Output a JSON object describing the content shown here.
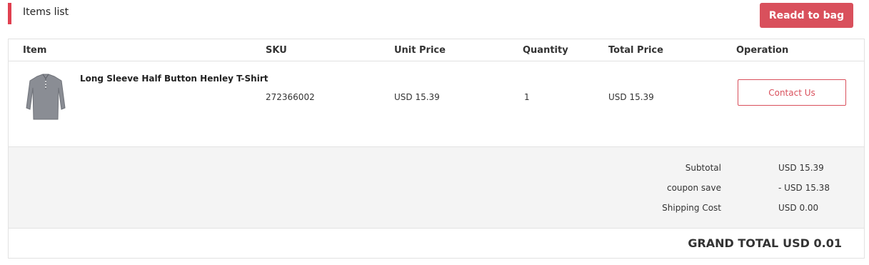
{
  "header": {
    "title": "Items list",
    "readd_label": "Readd to bag"
  },
  "table": {
    "columns": [
      "Item",
      "SKU",
      "Unit Price",
      "Quantity",
      "Total Price",
      "Operation"
    ],
    "rows": [
      {
        "name": "Long Sleeve Half Button Henley T-Shirt",
        "sku": "272366002",
        "unit_price": "USD 15.39",
        "quantity": "1",
        "total_price": "USD 15.39",
        "operation": "Contact Us"
      }
    ]
  },
  "summary": {
    "subtotal_label": "Subtotal",
    "subtotal_value": "USD 15.39",
    "coupon_label": "coupon save",
    "coupon_value": "- USD 15.38",
    "shipping_label": "Shipping Cost",
    "shipping_value": "USD 0.00"
  },
  "grand_total": {
    "label": "GRAND TOTAL",
    "value": "USD 0.01"
  },
  "colors": {
    "accent": "#d9505c",
    "header_bar": "#e04050",
    "summary_bg": "#f4f4f4"
  }
}
